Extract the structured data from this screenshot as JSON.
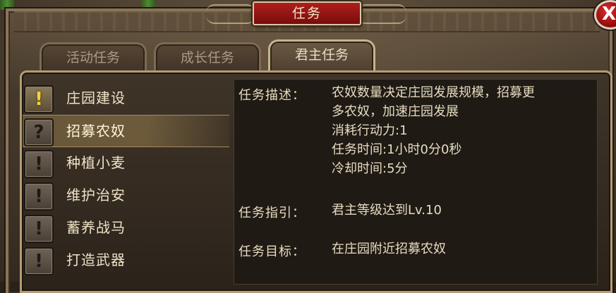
{
  "window": {
    "title": "任务",
    "close_label": "X"
  },
  "tabs": [
    {
      "label": "活动任务",
      "active": false
    },
    {
      "label": "成长任务",
      "active": false
    },
    {
      "label": "君主任务",
      "active": true
    }
  ],
  "quest_list": [
    {
      "label": "庄园建设",
      "icon": "exclamation-icon",
      "icon_glyph": "!",
      "icon_color": "gold",
      "selected": false
    },
    {
      "label": "招募农奴",
      "icon": "question-icon",
      "icon_glyph": "?",
      "icon_color": "gray",
      "selected": true
    },
    {
      "label": "种植小麦",
      "icon": "exclamation-icon",
      "icon_glyph": "!",
      "icon_color": "gray",
      "selected": false
    },
    {
      "label": "维护治安",
      "icon": "exclamation-icon",
      "icon_glyph": "!",
      "icon_color": "gray",
      "selected": false
    },
    {
      "label": "蓄养战马",
      "icon": "exclamation-icon",
      "icon_glyph": "!",
      "icon_color": "gray",
      "selected": false
    },
    {
      "label": "打造武器",
      "icon": "exclamation-icon",
      "icon_glyph": "!",
      "icon_color": "gray",
      "selected": false
    }
  ],
  "detail": {
    "description_label": "任务描述：",
    "description_lines": [
      "农奴数量决定庄园发展规模，招募更",
      "多农奴，加速庄园发展",
      "消耗行动力:1",
      "任务时间:1小时0分0秒",
      "冷却时间:5分"
    ],
    "guide_label": "任务指引：",
    "guide_text": "君主等级达到Lv.10",
    "goal_label": "任务目标：",
    "goal_text": "在庄园附近招募农奴"
  },
  "colors": {
    "title_red": "#b01d1d",
    "gold_icon": "#f5d23a",
    "text": "#efe3c8"
  }
}
